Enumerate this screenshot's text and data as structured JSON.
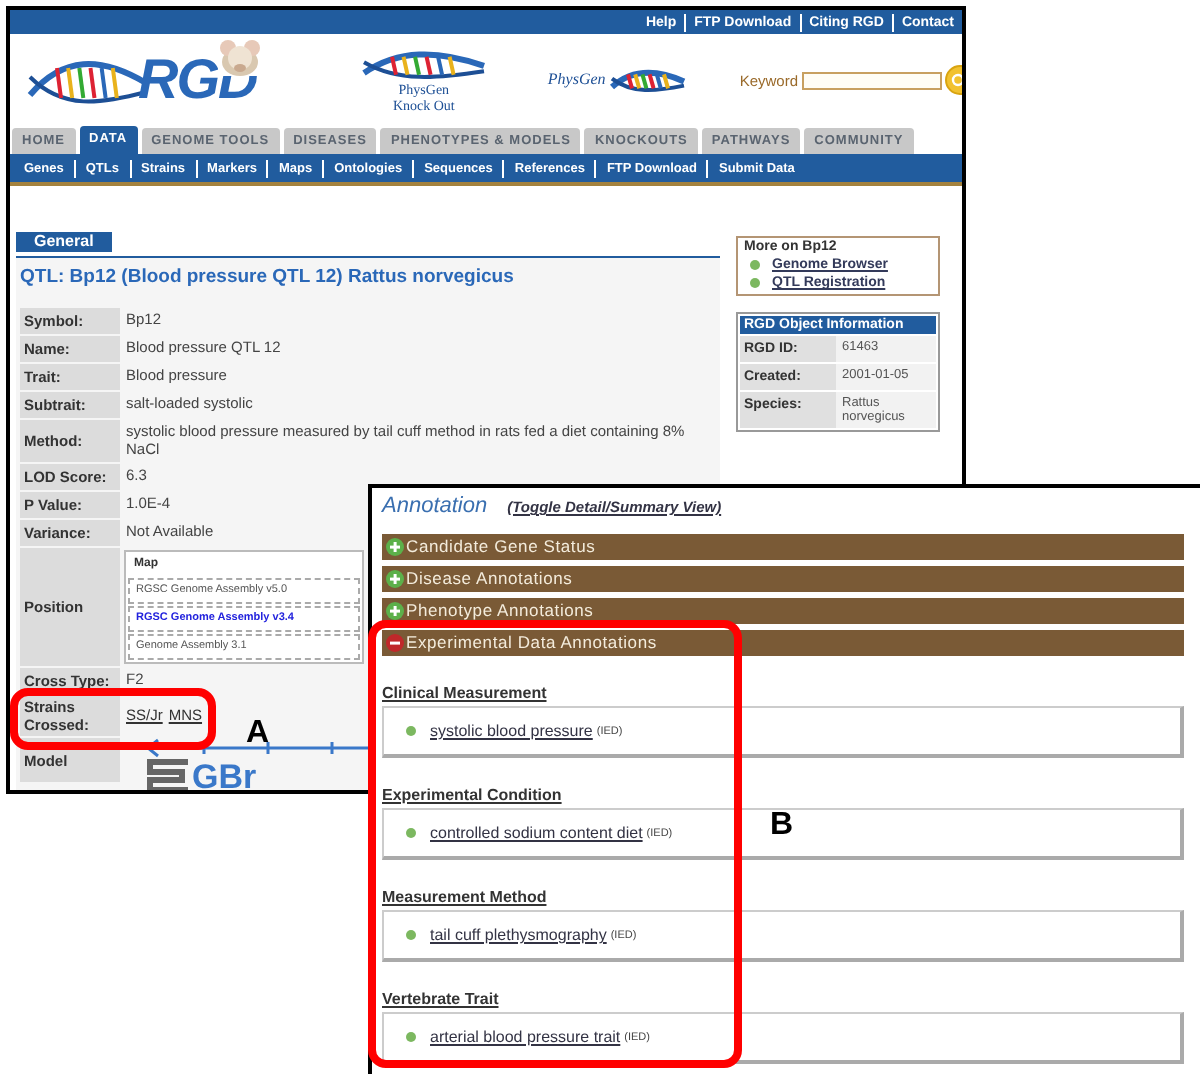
{
  "page": {
    "top_links": [
      "Help",
      "FTP Download",
      "Citing RGD",
      "Contact"
    ],
    "logos": {
      "main": "RGD",
      "knockout": [
        "PhysGen",
        "Knock Out"
      ],
      "physgen": "PhysGen"
    },
    "search": {
      "label": "Keyword"
    },
    "tabs": [
      {
        "label": "HOME",
        "selected": false
      },
      {
        "label": "DATA",
        "selected": true
      },
      {
        "label": "GENOME TOOLS",
        "selected": false
      },
      {
        "label": "DISEASES",
        "selected": false
      },
      {
        "label": "PHENOTYPES & MODELS",
        "selected": false
      },
      {
        "label": "KNOCKOUTS",
        "selected": false
      },
      {
        "label": "PATHWAYS",
        "selected": false
      },
      {
        "label": "COMMUNITY",
        "selected": false
      }
    ],
    "subnav": [
      "Genes",
      "QTLs",
      "Strains",
      "Markers",
      "Maps",
      "Ontologies",
      "Sequences",
      "References",
      "FTP Download",
      "Submit Data"
    ],
    "section_tab": "General",
    "title": "QTL: Bp12 (Blood pressure QTL 12) Rattus norvegicus",
    "fields": [
      {
        "kind": "text",
        "label": "Symbol:",
        "value": "Bp12"
      },
      {
        "kind": "text",
        "label": "Name:",
        "value": "Blood pressure QTL 12"
      },
      {
        "kind": "text",
        "label": "Trait:",
        "value": "Blood pressure"
      },
      {
        "kind": "text",
        "label": "Subtrait:",
        "value": "salt-loaded systolic"
      },
      {
        "kind": "text",
        "label": "Method:",
        "value": "systolic blood pressure measured by tail cuff method in rats fed a diet containing 8% NaCl"
      },
      {
        "kind": "text",
        "label": "LOD Score:",
        "value": "6.3"
      },
      {
        "kind": "text",
        "label": "P Value:",
        "value": "1.0E-4"
      },
      {
        "kind": "text",
        "label": "Variance:",
        "value": "Not Available"
      },
      {
        "kind": "map",
        "label": "Position",
        "header": "Map",
        "assemblies": [
          {
            "name": "RGSC Genome Assembly v5.0",
            "selected": false
          },
          {
            "name": "RGSC Genome Assembly v3.4",
            "selected": true
          },
          {
            "name": "Genome Assembly 3.1",
            "selected": false
          }
        ]
      },
      {
        "kind": "text",
        "label": "Cross Type:",
        "value": "F2"
      },
      {
        "kind": "links",
        "label": "Strains Crossed:",
        "links": [
          "SS/Jr",
          "MNS"
        ]
      },
      {
        "kind": "logo",
        "label": "Model",
        "text": "GBr"
      }
    ],
    "more": {
      "title": "More on Bp12",
      "links": [
        "Genome Browser",
        "QTL Registration"
      ]
    },
    "object_info": {
      "title": "RGD Object Information",
      "rows": [
        {
          "label": "RGD ID:",
          "value": "61463"
        },
        {
          "label": "Created:",
          "value": "2001-01-05"
        },
        {
          "label": "Species:",
          "value": "Rattus norvegicus"
        }
      ]
    }
  },
  "annotation_panel": {
    "title": "Annotation",
    "toggle": "(Toggle Detail/Summary View)",
    "sections": [
      {
        "label": "Candidate Gene Status",
        "expanded": false
      },
      {
        "label": "Disease Annotations",
        "expanded": false
      },
      {
        "label": "Phenotype Annotations",
        "expanded": false
      },
      {
        "label": "Experimental Data Annotations",
        "expanded": true
      }
    ],
    "groups": [
      {
        "heading": "Clinical Measurement",
        "items": [
          {
            "term": "systolic blood pressure",
            "evidence": "(IED)"
          }
        ]
      },
      {
        "heading": "Experimental Condition",
        "items": [
          {
            "term": "controlled sodium content diet",
            "evidence": "(IED)"
          }
        ]
      },
      {
        "heading": "Measurement Method",
        "items": [
          {
            "term": "tail cuff plethysmography",
            "evidence": "(IED)"
          }
        ]
      },
      {
        "heading": "Vertebrate Trait",
        "items": [
          {
            "term": "arterial blood pressure trait",
            "evidence": "(IED)"
          }
        ]
      }
    ]
  },
  "callouts": [
    {
      "label": "A"
    },
    {
      "label": "B"
    }
  ]
}
